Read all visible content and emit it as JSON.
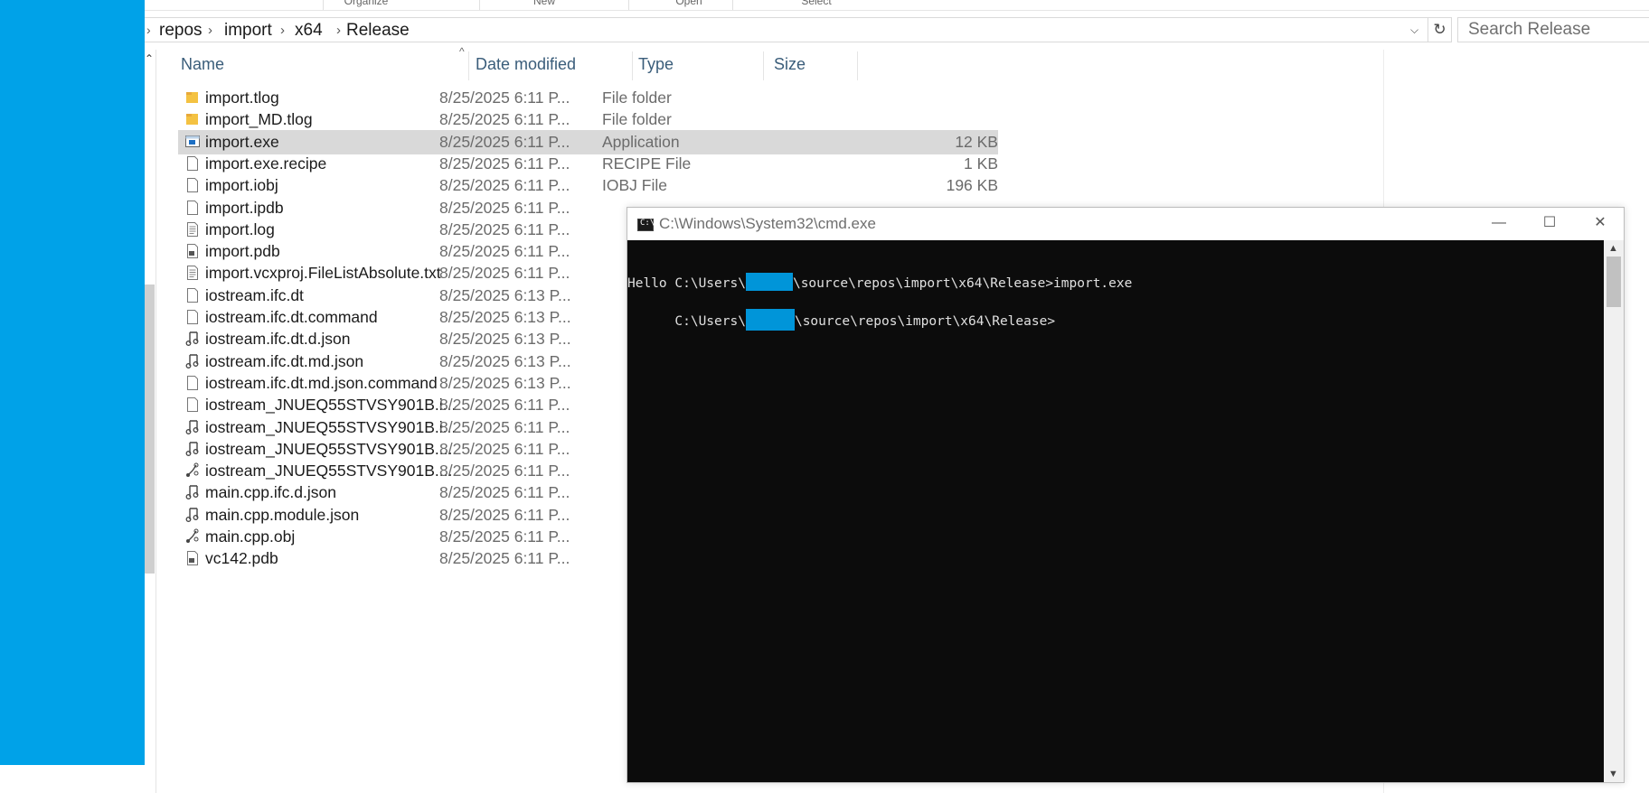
{
  "ribbon": {
    "groups": [
      "Organize",
      "New",
      "Open",
      "Select"
    ]
  },
  "address": {
    "crumbs": [
      "repos",
      "import",
      "x64",
      "Release"
    ],
    "separator": "›",
    "search_placeholder": "Search Release"
  },
  "columns": {
    "name": "Name",
    "date": "Date modified",
    "type": "Type",
    "size": "Size"
  },
  "files": [
    {
      "name": "import.tlog",
      "date": "8/25/2025 6:11 P...",
      "type": "File folder",
      "size": "",
      "icon": "folder-icon"
    },
    {
      "name": "import_MD.tlog",
      "date": "8/25/2025 6:11 P...",
      "type": "File folder",
      "size": "",
      "icon": "folder-icon"
    },
    {
      "name": "import.exe",
      "date": "8/25/2025 6:11 P...",
      "type": "Application",
      "size": "12 KB",
      "icon": "application-icon"
    },
    {
      "name": "import.exe.recipe",
      "date": "8/25/2025 6:11 P...",
      "type": "RECIPE File",
      "size": "1 KB",
      "icon": "file-icon"
    },
    {
      "name": "import.iobj",
      "date": "8/25/2025 6:11 P...",
      "type": "IOBJ File",
      "size": "196 KB",
      "icon": "file-icon"
    },
    {
      "name": "import.ipdb",
      "date": "8/25/2025 6:11 P...",
      "type": "",
      "size": "",
      "icon": "file-icon"
    },
    {
      "name": "import.log",
      "date": "8/25/2025 6:11 P...",
      "type": "",
      "size": "",
      "icon": "text-file-icon"
    },
    {
      "name": "import.pdb",
      "date": "8/25/2025 6:11 P...",
      "type": "",
      "size": "",
      "icon": "pdb-file-icon"
    },
    {
      "name": "import.vcxproj.FileListAbsolute.txt",
      "date": "8/25/2025 6:11 P...",
      "type": "",
      "size": "",
      "icon": "text-file-icon"
    },
    {
      "name": "iostream.ifc.dt",
      "date": "8/25/2025 6:13 P...",
      "type": "",
      "size": "",
      "icon": "file-icon"
    },
    {
      "name": "iostream.ifc.dt.command",
      "date": "8/25/2025 6:13 P...",
      "type": "",
      "size": "",
      "icon": "file-icon"
    },
    {
      "name": "iostream.ifc.dt.d.json",
      "date": "8/25/2025 6:13 P...",
      "type": "",
      "size": "",
      "icon": "json-file-icon"
    },
    {
      "name": "iostream.ifc.dt.md.json",
      "date": "8/25/2025 6:13 P...",
      "type": "",
      "size": "",
      "icon": "json-file-icon"
    },
    {
      "name": "iostream.ifc.dt.md.json.command",
      "date": "8/25/2025 6:13 P...",
      "type": "",
      "size": "",
      "icon": "file-icon"
    },
    {
      "name": "iostream_JNUEQ55STVSY901B.i...",
      "date": "8/25/2025 6:11 P...",
      "type": "",
      "size": "",
      "icon": "file-icon"
    },
    {
      "name": "iostream_JNUEQ55STVSY901B.i...",
      "date": "8/25/2025 6:11 P...",
      "type": "",
      "size": "",
      "icon": "json-file-icon"
    },
    {
      "name": "iostream_JNUEQ55STVSY901B....",
      "date": "8/25/2025 6:11 P...",
      "type": "",
      "size": "",
      "icon": "json-file-icon"
    },
    {
      "name": "iostream_JNUEQ55STVSY901B....",
      "date": "8/25/2025 6:11 P...",
      "type": "",
      "size": "",
      "icon": "object-file-icon"
    },
    {
      "name": "main.cpp.ifc.d.json",
      "date": "8/25/2025 6:11 P...",
      "type": "",
      "size": "",
      "icon": "json-file-icon"
    },
    {
      "name": "main.cpp.module.json",
      "date": "8/25/2025 6:11 P...",
      "type": "",
      "size": "",
      "icon": "json-file-icon"
    },
    {
      "name": "main.cpp.obj",
      "date": "8/25/2025 6:11 P...",
      "type": "",
      "size": "",
      "icon": "object-file-icon"
    },
    {
      "name": "vc142.pdb",
      "date": "8/25/2025 6:11 P...",
      "type": "",
      "size": "",
      "icon": "pdb-file-icon"
    }
  ],
  "selected_file": "import.exe",
  "cmd": {
    "title": "C:\\Windows\\System32\\cmd.exe",
    "icon_label": "C:\\",
    "lines": [
      {
        "prefix": "C:\\Users\\",
        "suffix": "\\source\\repos\\import\\x64\\Release>import.exe"
      },
      {
        "text": "Hello"
      },
      {
        "prefix": "C:\\Users\\",
        "suffix": "\\source\\repos\\import\\x64\\Release>"
      }
    ],
    "minimize": "—",
    "maximize": "☐",
    "close": "✕"
  },
  "colors": {
    "accent": "#00a2e8",
    "redaction": "#0095d9",
    "selection": "#d9d9d9",
    "console_bg": "#0c0c0c"
  }
}
